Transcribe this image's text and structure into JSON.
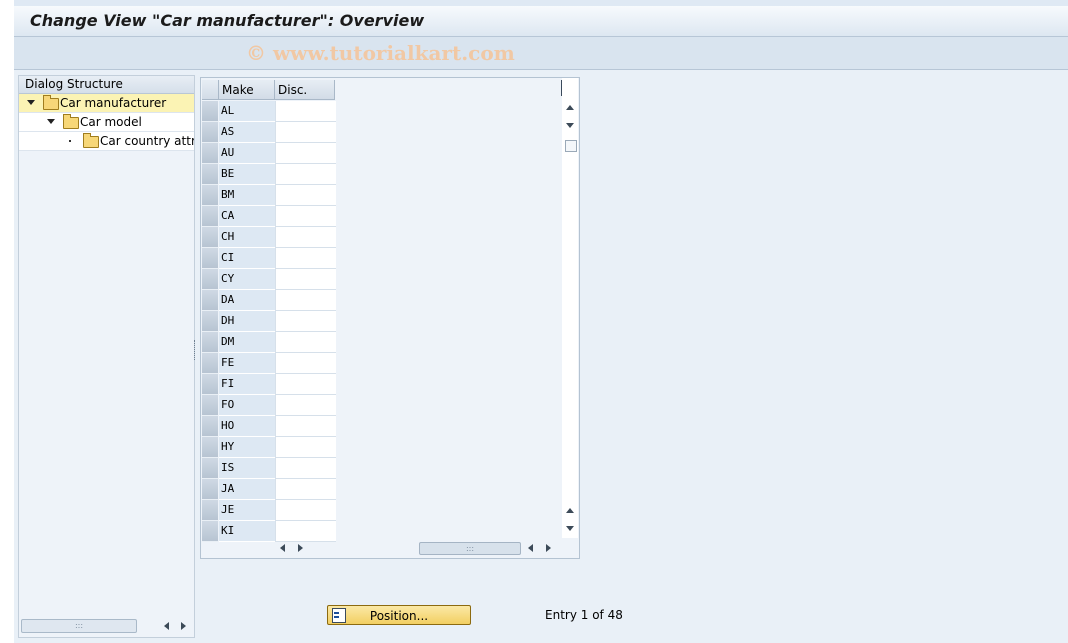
{
  "window": {
    "title": "Change View \"Car manufacturer\": Overview"
  },
  "watermark": "© www.tutorialkart.com",
  "dialog_structure": {
    "header": "Dialog Structure",
    "items": [
      {
        "label": "Car manufacturer",
        "selected": true,
        "expanded": true
      },
      {
        "label": "Car model",
        "selected": false,
        "expanded": true
      },
      {
        "label": "Car country attrib",
        "selected": false,
        "expanded": false
      }
    ]
  },
  "table": {
    "columns": [
      "Make",
      "Disc."
    ],
    "rows": [
      {
        "make": "AL",
        "disc": ""
      },
      {
        "make": "AS",
        "disc": ""
      },
      {
        "make": "AU",
        "disc": ""
      },
      {
        "make": "BE",
        "disc": ""
      },
      {
        "make": "BM",
        "disc": ""
      },
      {
        "make": "CA",
        "disc": ""
      },
      {
        "make": "CH",
        "disc": ""
      },
      {
        "make": "CI",
        "disc": ""
      },
      {
        "make": "CY",
        "disc": ""
      },
      {
        "make": "DA",
        "disc": ""
      },
      {
        "make": "DH",
        "disc": ""
      },
      {
        "make": "DM",
        "disc": ""
      },
      {
        "make": "FE",
        "disc": ""
      },
      {
        "make": "FI",
        "disc": ""
      },
      {
        "make": "FO",
        "disc": ""
      },
      {
        "make": "HO",
        "disc": ""
      },
      {
        "make": "HY",
        "disc": ""
      },
      {
        "make": "IS",
        "disc": ""
      },
      {
        "make": "JA",
        "disc": ""
      },
      {
        "make": "JE",
        "disc": ""
      },
      {
        "make": "KI",
        "disc": ""
      }
    ]
  },
  "footer": {
    "position_label": "Position...",
    "entry_info": "Entry 1 of 48"
  },
  "colors": {
    "selected_tree_item": "#fbf3b4",
    "position_button": "#f2cf62"
  }
}
